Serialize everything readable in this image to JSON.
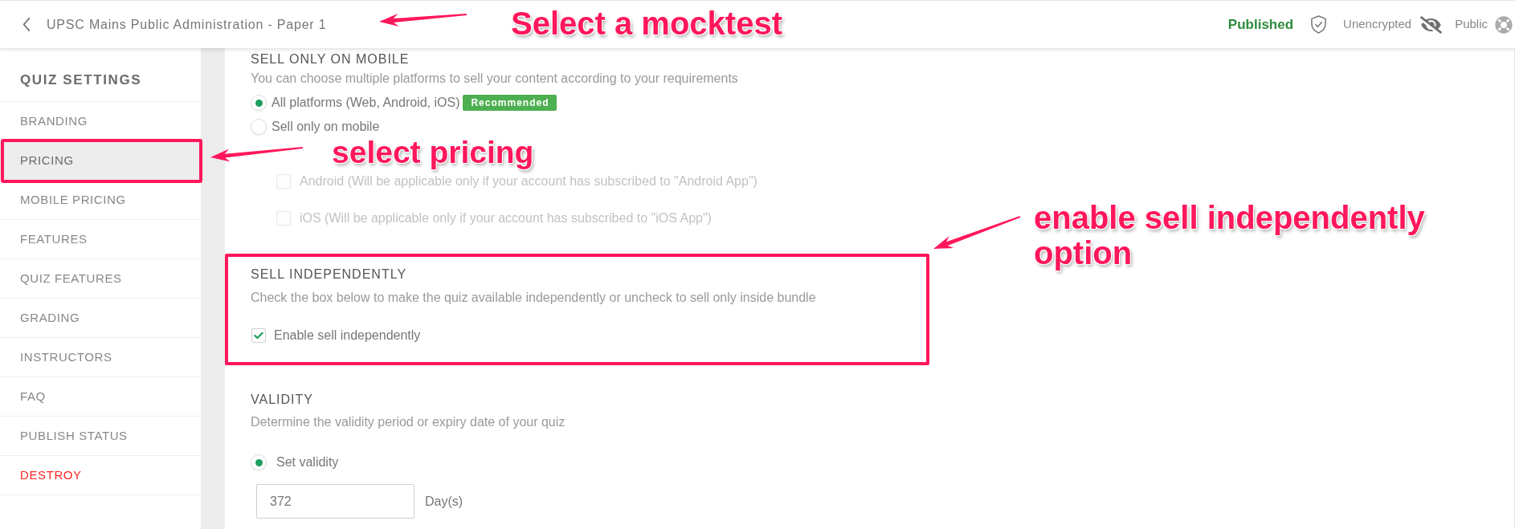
{
  "header": {
    "title": "UPSC Mains Public Administration - Paper 1",
    "status": "Published",
    "encryption": "Unencrypted",
    "visibility": "Public",
    "annotation": "Select a mocktest"
  },
  "sidebar": {
    "heading": "QUIZ SETTINGS",
    "items": [
      {
        "label": "BRANDING",
        "selected": false,
        "kind": "normal"
      },
      {
        "label": "PRICING",
        "selected": true,
        "kind": "normal"
      },
      {
        "label": "MOBILE PRICING",
        "selected": false,
        "kind": "normal"
      },
      {
        "label": "FEATURES",
        "selected": false,
        "kind": "normal"
      },
      {
        "label": "QUIZ FEATURES",
        "selected": false,
        "kind": "normal"
      },
      {
        "label": "GRADING",
        "selected": false,
        "kind": "normal"
      },
      {
        "label": "INSTRUCTORS",
        "selected": false,
        "kind": "normal"
      },
      {
        "label": "FAQ",
        "selected": false,
        "kind": "normal"
      },
      {
        "label": "PUBLISH STATUS",
        "selected": false,
        "kind": "normal"
      },
      {
        "label": "DESTROY",
        "selected": false,
        "kind": "danger"
      }
    ],
    "annotation": "select pricing"
  },
  "sell_on_mobile": {
    "heading": "SELL ONLY ON MOBILE",
    "description": "You can choose multiple platforms to sell your content according to your requirements",
    "options": [
      {
        "label": "All platforms (Web, Android, iOS)",
        "selected": true,
        "badge": "Recommended"
      },
      {
        "label": "Sell only on mobile",
        "selected": false
      }
    ],
    "sub_options": [
      {
        "label": "Android (Will be applicable only if your account has subscribed to \"Android App\")",
        "checked": false,
        "disabled": true
      },
      {
        "label": "iOS (Will be applicable only if your account has subscribed to \"iOS App\")",
        "checked": false,
        "disabled": true
      }
    ]
  },
  "sell_independently": {
    "heading": "SELL INDEPENDENTLY",
    "description": "Check the box below to make the quiz available independently or uncheck to sell only inside bundle",
    "checkbox": {
      "label": "Enable sell independently",
      "checked": true
    },
    "annotation": "enable sell independently option"
  },
  "validity": {
    "heading": "VALIDITY",
    "description": "Determine the validity period or expiry date of your quiz",
    "option": {
      "label": "Set validity",
      "selected": true
    },
    "input": {
      "value": "372"
    },
    "unit": "Day(s)"
  }
}
